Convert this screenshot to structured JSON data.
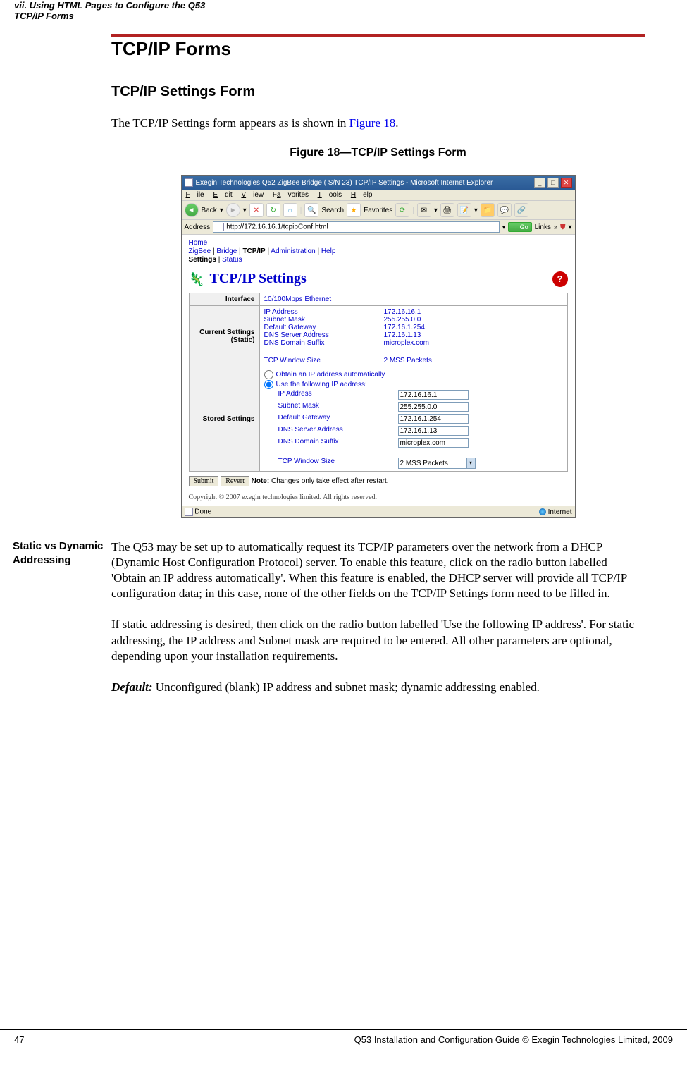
{
  "header": {
    "section": "vii. Using HTML Pages to Configure the Q53",
    "subsection": "TCP/IP Forms"
  },
  "h1": "TCP/IP Forms",
  "h2": "TCP/IP Settings Form",
  "intro_pre": "The TCP/IP Settings form appears as is shown in ",
  "intro_link": "Figure 18",
  "intro_post": ".",
  "fig_caption": "Figure 18—TCP/IP Settings Form",
  "ie": {
    "title": "Exegin Technologies Q52 ZigBee Bridge ( S/N 23) TCP/IP Settings - Microsoft Internet Explorer",
    "menu": {
      "file": "File",
      "edit": "Edit",
      "view": "View",
      "fav": "Favorites",
      "tools": "Tools",
      "help": "Help"
    },
    "toolbar": {
      "back": "Back",
      "search": "Search",
      "favorites": "Favorites"
    },
    "address_label": "Address",
    "url": "http://172.16.16.1/tcpipConf.html",
    "go": "Go",
    "links": "Links",
    "nav": {
      "home": "Home",
      "zigbee": "ZigBee",
      "bridge": "Bridge",
      "tcpip": "TCP/IP",
      "admin": "Administration",
      "help": "Help",
      "settings": "Settings",
      "status": "Status"
    },
    "page_title": "TCP/IP Settings",
    "rows": {
      "interface_label": "Interface",
      "interface_value": "10/100Mbps Ethernet",
      "current_label": "Current Settings (Static)",
      "ip_k": "IP Address",
      "ip_v": "172.16.16.1",
      "mask_k": "Subnet Mask",
      "mask_v": "255.255.0.0",
      "gw_k": "Default Gateway",
      "gw_v": "172.16.1.254",
      "dns_k": "DNS Server Address",
      "dns_v": "172.16.1.13",
      "suf_k": "DNS Domain Suffix",
      "suf_v": "microplex.com",
      "tcp_k": "TCP Window Size",
      "tcp_v": "2 MSS Packets",
      "stored_label": "Stored Settings",
      "opt_auto": "Obtain an IP address automatically",
      "opt_static": "Use the following IP address:",
      "s_ip": "172.16.16.1",
      "s_mask": "255.255.0.0",
      "s_gw": "172.16.1.254",
      "s_dns": "172.16.1.13",
      "s_suf": "microplex.com",
      "s_tcp": "2 MSS Packets"
    },
    "submit": "Submit",
    "revert": "Revert",
    "note_label": "Note:",
    "note_text": " Changes only take effect after restart.",
    "copyright": "Copyright © 2007 exegin technologies limited. All rights reserved.",
    "status_done": "Done",
    "status_zone": "Internet"
  },
  "side_heading": "Static vs Dynamic Addressing",
  "para1": "The Q53 may be set up to automatically request its TCP/IP parameters over the network from a DHCP (Dynamic Host Configuration Protocol) server. To enable this feature, click on the radio button labelled 'Obtain an IP address automatically'. When this feature is enabled, the DHCP server will provide all TCP/IP configuration data; in this case, none of the other fields on the TCP/IP Settings form need to be filled in.",
  "para2": "If static addressing is desired, then click on the radio button labelled 'Use the following IP address'. For static addressing, the IP address and Subnet mask are required to be entered. All other parameters are optional, depending upon your installation requirements.",
  "default_label": "Default:",
  "default_text": " Unconfigured (blank) IP address and subnet mask; dynamic addressing enabled.",
  "footer": {
    "page": "47",
    "text": "Q53 Installation and Configuration Guide  © Exegin Technologies Limited, 2009"
  }
}
